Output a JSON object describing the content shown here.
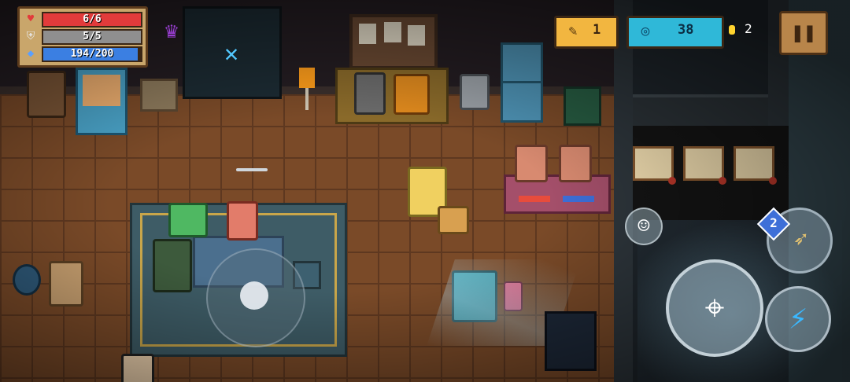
{
  "hud": {
    "health": {
      "current": 6,
      "max": 6,
      "text": "6/6",
      "color": "#e23b3b",
      "icon": "heart-icon"
    },
    "armor": {
      "current": 5,
      "max": 5,
      "text": "5/5",
      "color": "#8f8f8f",
      "icon": "shield-icon"
    },
    "energy": {
      "current": 194,
      "max": 200,
      "text": "194/200",
      "color": "#3b7fe2",
      "icon": "diamond-icon"
    }
  },
  "resources": {
    "materials": {
      "value": "1",
      "icon": "feather-icon",
      "color": "#f2b640"
    },
    "gems": {
      "value": "38",
      "icon": "gem-icon",
      "color": "#2fb8d8"
    },
    "coins": {
      "value": "2",
      "icon": "coin-icon",
      "color": "#ffd42e"
    }
  },
  "controls": {
    "pause_icon": "pause-icon",
    "emote_icon": "smiley-icon",
    "weapon_icon": "bow-icon",
    "weapon_badge": "2",
    "attack_icon": "crosshair-icon",
    "skill_icon": "lightning-icon"
  },
  "glyphs": {
    "heart": "♥",
    "shield": "⛨",
    "diamond": "◆",
    "feather": "✎",
    "gem": "◎",
    "pause": "❚❚",
    "smiley": "☺",
    "bow": "➶",
    "crosshair": "⌖",
    "lightning": "⚡",
    "boss": "♛",
    "guild": "✕"
  }
}
